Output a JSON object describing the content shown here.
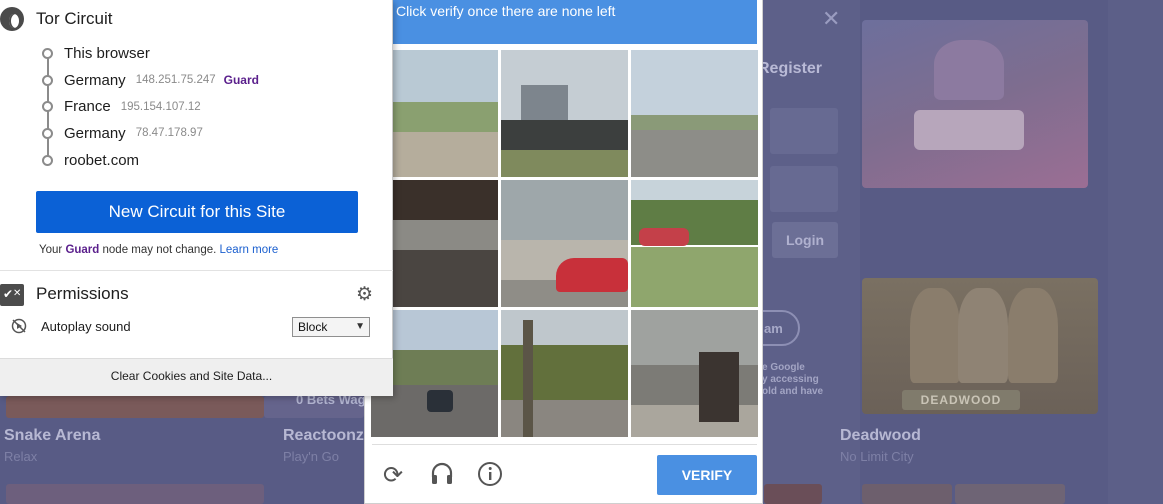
{
  "tor_panel": {
    "title": "Tor Circuit",
    "circuit": [
      {
        "label": "This browser",
        "ip": "",
        "tag": ""
      },
      {
        "label": "Germany",
        "ip": "148.251.75.247",
        "tag": "Guard"
      },
      {
        "label": "France",
        "ip": "195.154.107.12",
        "tag": ""
      },
      {
        "label": "Germany",
        "ip": "78.47.178.97",
        "tag": ""
      },
      {
        "label": "roobet.com",
        "ip": "",
        "tag": ""
      }
    ],
    "new_circuit_button": "New Circuit for this Site",
    "guard_note": {
      "prefix": "Your ",
      "guard": "Guard",
      "middle": " node may not change. ",
      "learn_more": "Learn more"
    },
    "permissions": {
      "title": "Permissions",
      "autoplay_label": "Autoplay sound",
      "autoplay_value": "Block"
    },
    "clear_button": "Clear Cookies and Site Data..."
  },
  "captcha": {
    "instruction": "Click verify once there are none left",
    "verify_button": "VERIFY",
    "accent_color": "#4a90e2"
  },
  "background": {
    "register": "Register",
    "login": "Login",
    "pill_partial": "am",
    "google_text": "e Google\ny accessing\nold and have",
    "bets_text": "0 Bets Wag",
    "games": [
      {
        "name": "Snake Arena",
        "provider": "Relax"
      },
      {
        "name": "Reactoonz",
        "provider": "Play'n Go"
      },
      {
        "name": "Deadwood",
        "provider": "No Limit City"
      }
    ],
    "deadwood_logo": "DEADWOOD"
  }
}
